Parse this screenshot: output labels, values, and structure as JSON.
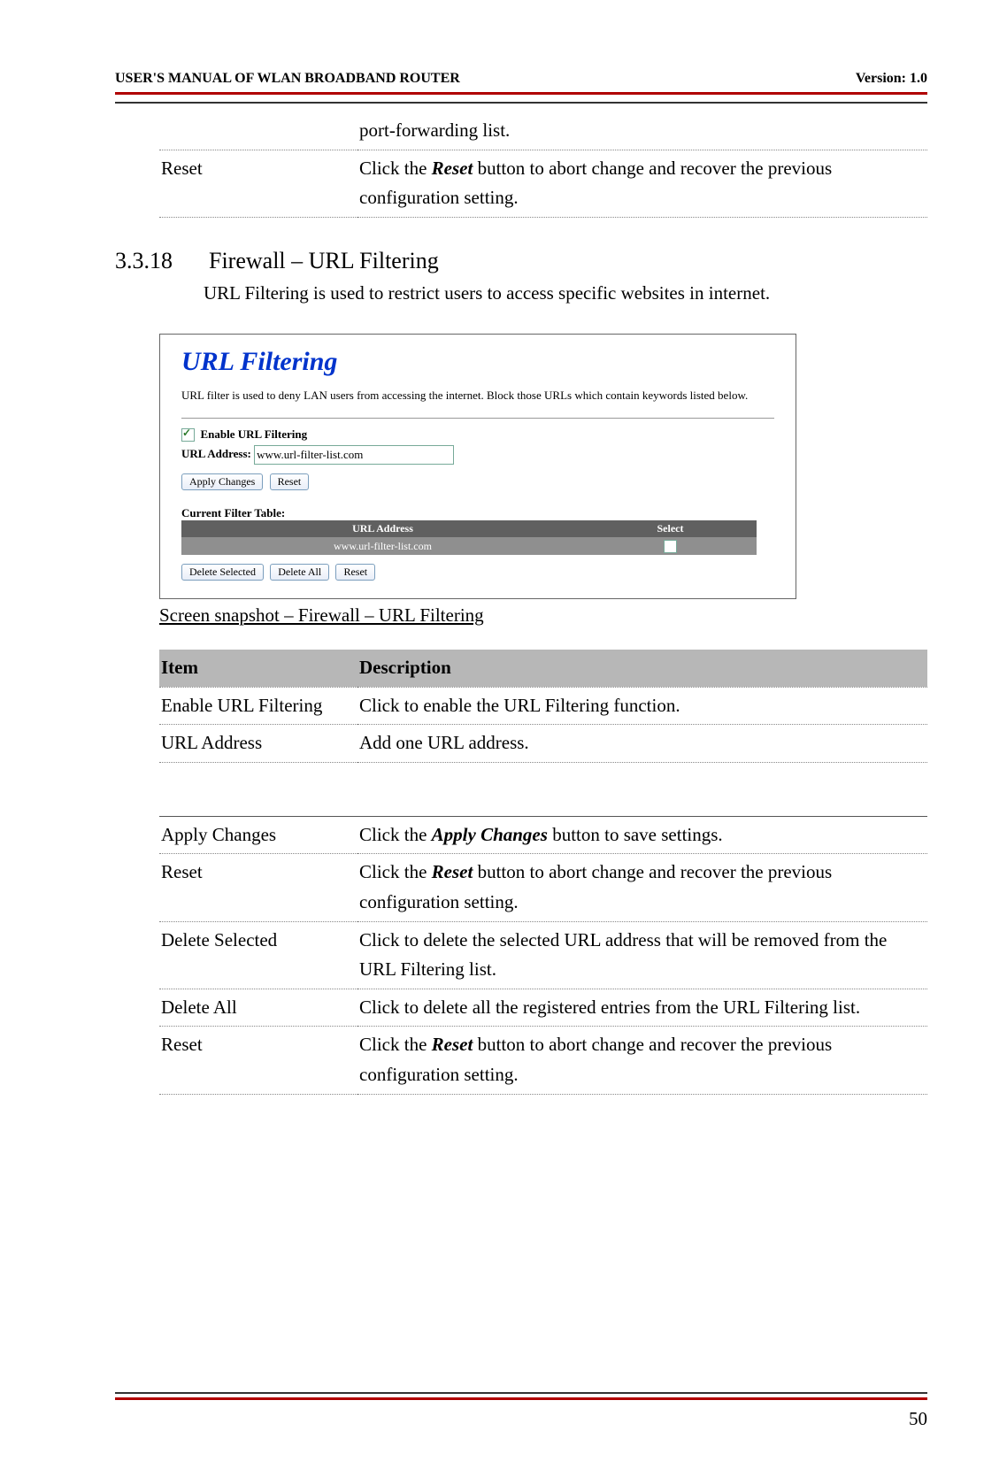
{
  "header": {
    "left": "USER'S MANUAL OF WLAN BROADBAND ROUTER",
    "right": "Version: 1.0"
  },
  "top_table": {
    "rows": [
      {
        "item": "",
        "desc": "port-forwarding list."
      },
      {
        "item": "Reset",
        "desc_pre": "Click the ",
        "desc_bolditalic": "Reset",
        "desc_post": " button to abort change and recover the previous configuration setting."
      }
    ]
  },
  "section": {
    "number": "3.3.18",
    "title": "Firewall – URL Filtering",
    "intro": "URL Filtering is used to restrict users to access specific websites in internet."
  },
  "screenshot": {
    "title": "URL Filtering",
    "desc": "URL filter is used to deny LAN users from accessing the internet. Block those URLs which contain keywords listed below.",
    "enable_label": "Enable URL Filtering",
    "url_label": "URL Address:",
    "url_value": "www.url-filter-list.com",
    "btn_apply": "Apply Changes",
    "btn_reset": "Reset",
    "filter_table_label": "Current Filter Table:",
    "filter_cols": [
      "URL Address",
      "Select"
    ],
    "filter_rows": [
      {
        "url": "www.url-filter-list.com",
        "select": false
      }
    ],
    "btn_delete_selected": "Delete Selected",
    "btn_delete_all": "Delete All",
    "btn_reset2": "Reset"
  },
  "caption": "Screen snapshot – Firewall – URL Filtering",
  "desc_table": {
    "head": [
      "Item",
      "Description"
    ],
    "rows": [
      {
        "item": "Enable URL Filtering",
        "desc": "Click to enable the URL Filtering function."
      },
      {
        "item": "URL Address",
        "desc": "Add one URL address."
      }
    ]
  },
  "desc_table2": {
    "rows": [
      {
        "item": "Apply Changes",
        "desc_pre": "Click the ",
        "desc_bolditalic": "Apply Changes",
        "desc_post": " button to save settings."
      },
      {
        "item": "Reset",
        "desc_pre": "Click the ",
        "desc_bolditalic": "Reset",
        "desc_post": " button to abort change and recover the previous configuration setting."
      },
      {
        "item": "Delete Selected",
        "desc": "Click to delete the selected URL address that will be removed from the URL Filtering list."
      },
      {
        "item": "Delete All",
        "desc": "Click to delete all the registered entries from the URL Filtering list."
      },
      {
        "item": "Reset",
        "desc_pre": "Click the ",
        "desc_bolditalic": "Reset",
        "desc_post": " button to abort change and recover the previous configuration setting."
      }
    ]
  },
  "page_number": "50"
}
